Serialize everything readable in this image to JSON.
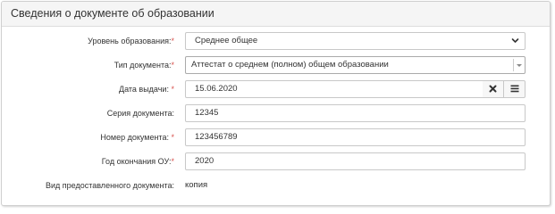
{
  "panel": {
    "title": "Сведения о документе об образовании"
  },
  "form": {
    "required_mark": "*",
    "education_level": {
      "label": "Уровень образования:",
      "value": "Среднее общее"
    },
    "document_type": {
      "label": "Тип документа:",
      "value": "Аттестат о среднем (полном) общем образовании"
    },
    "issue_date": {
      "label": "Дата выдачи:",
      "value": "15.06.2020"
    },
    "series": {
      "label": "Серия документа:",
      "value": "12345"
    },
    "number": {
      "label": "Номер документа:",
      "value": "123456789"
    },
    "graduation_year": {
      "label": "Год окончания ОУ:",
      "value": "2020"
    },
    "document_kind": {
      "label": "Вид предоставленного документа:",
      "value": "копия"
    }
  },
  "icons": {
    "select_chevron": "chevron-down-icon",
    "select2_caret": "caret-down-icon",
    "clear": "close-icon",
    "calendar": "calendar-icon"
  }
}
